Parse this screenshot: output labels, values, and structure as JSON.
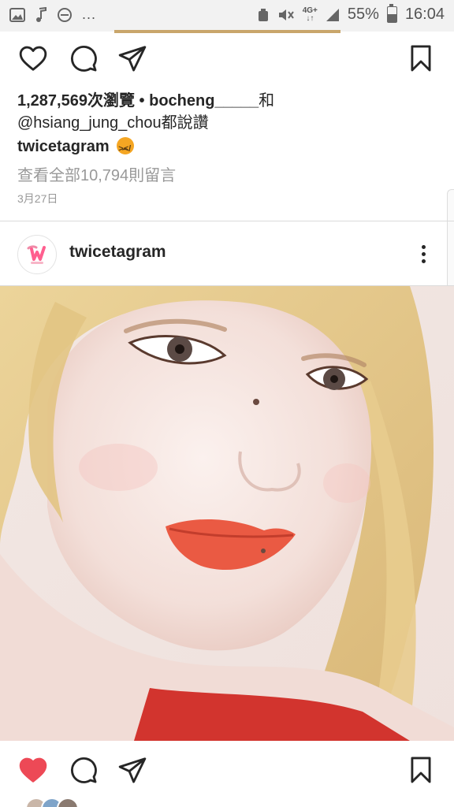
{
  "status_bar": {
    "left_icons": [
      "image-icon",
      "music-note-icon",
      "do-not-disturb-icon"
    ],
    "more": "...",
    "network": "4G+",
    "battery_percent": "55%",
    "time": "16:04",
    "battery_level": 0.55
  },
  "post1": {
    "likes_count": "1,287,569次瀏覽",
    "liked_by_prefix": "•",
    "liked_by_user": "bocheng_____",
    "liked_by_and": "和",
    "liked_by_user2": "@hsiang_jung_chou",
    "liked_by_suffix": "都說讚",
    "caption_user": "twicetagram",
    "caption_emoji": "squinting-face-emoji",
    "view_all_comments": "查看全部10,794則留言",
    "date": "3月27日"
  },
  "post2": {
    "username": "twicetagram",
    "avatar_logo": "twice-logo",
    "liked": true
  },
  "colors": {
    "like_red": "#ed4956",
    "text": "#262626",
    "muted": "#999999",
    "divider": "#dbdbdb"
  }
}
